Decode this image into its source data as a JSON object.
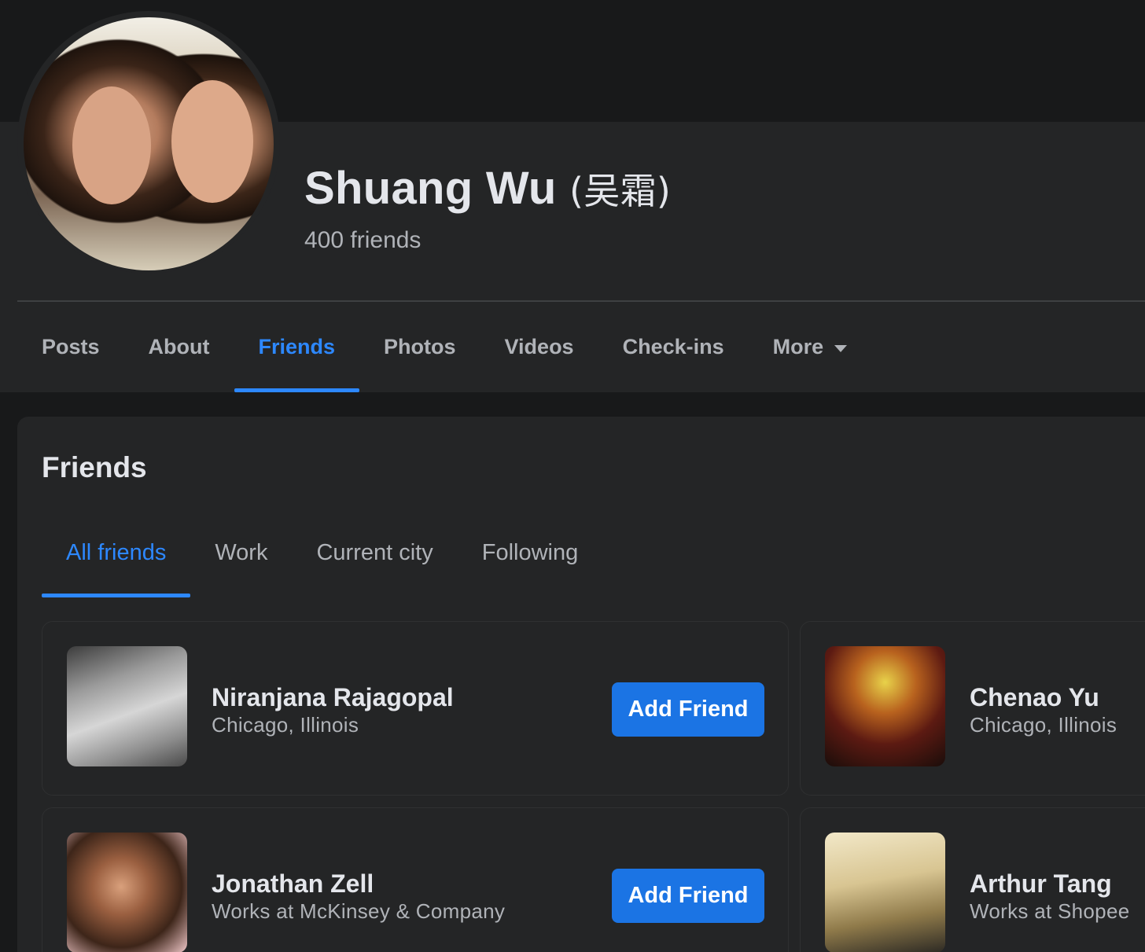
{
  "profile": {
    "name": "Shuang Wu",
    "name_alt": "(吴霜)",
    "friend_count": "400 friends",
    "avatar_icon": "profile-photo"
  },
  "nav": {
    "tabs": [
      {
        "label": "Posts",
        "active": false
      },
      {
        "label": "About",
        "active": false
      },
      {
        "label": "Friends",
        "active": true
      },
      {
        "label": "Photos",
        "active": false
      },
      {
        "label": "Videos",
        "active": false
      },
      {
        "label": "Check-ins",
        "active": false
      },
      {
        "label": "More",
        "active": false
      }
    ],
    "more_icon": "caret-down-icon"
  },
  "friends_section": {
    "title": "Friends",
    "subtabs": [
      {
        "label": "All friends",
        "active": true
      },
      {
        "label": "Work",
        "active": false
      },
      {
        "label": "Current city",
        "active": false
      },
      {
        "label": "Following",
        "active": false
      }
    ],
    "friends": [
      {
        "name": "Niranjana Rajagopal",
        "detail": "Chicago, Illinois",
        "button": "Add Friend"
      },
      {
        "name": "Chenao Yu",
        "detail": "Chicago, Illinois",
        "button": ""
      },
      {
        "name": "Jonathan Zell",
        "detail": "Works at McKinsey & Company",
        "button": "Add Friend"
      },
      {
        "name": "Arthur Tang",
        "detail": "Works at Shopee",
        "button": ""
      }
    ]
  },
  "colors": {
    "accent": "#2d88ff",
    "button": "#1b74e4",
    "panel": "#242526",
    "background": "#18191a",
    "text_primary": "#e4e6eb",
    "text_secondary": "#b0b3b8"
  }
}
